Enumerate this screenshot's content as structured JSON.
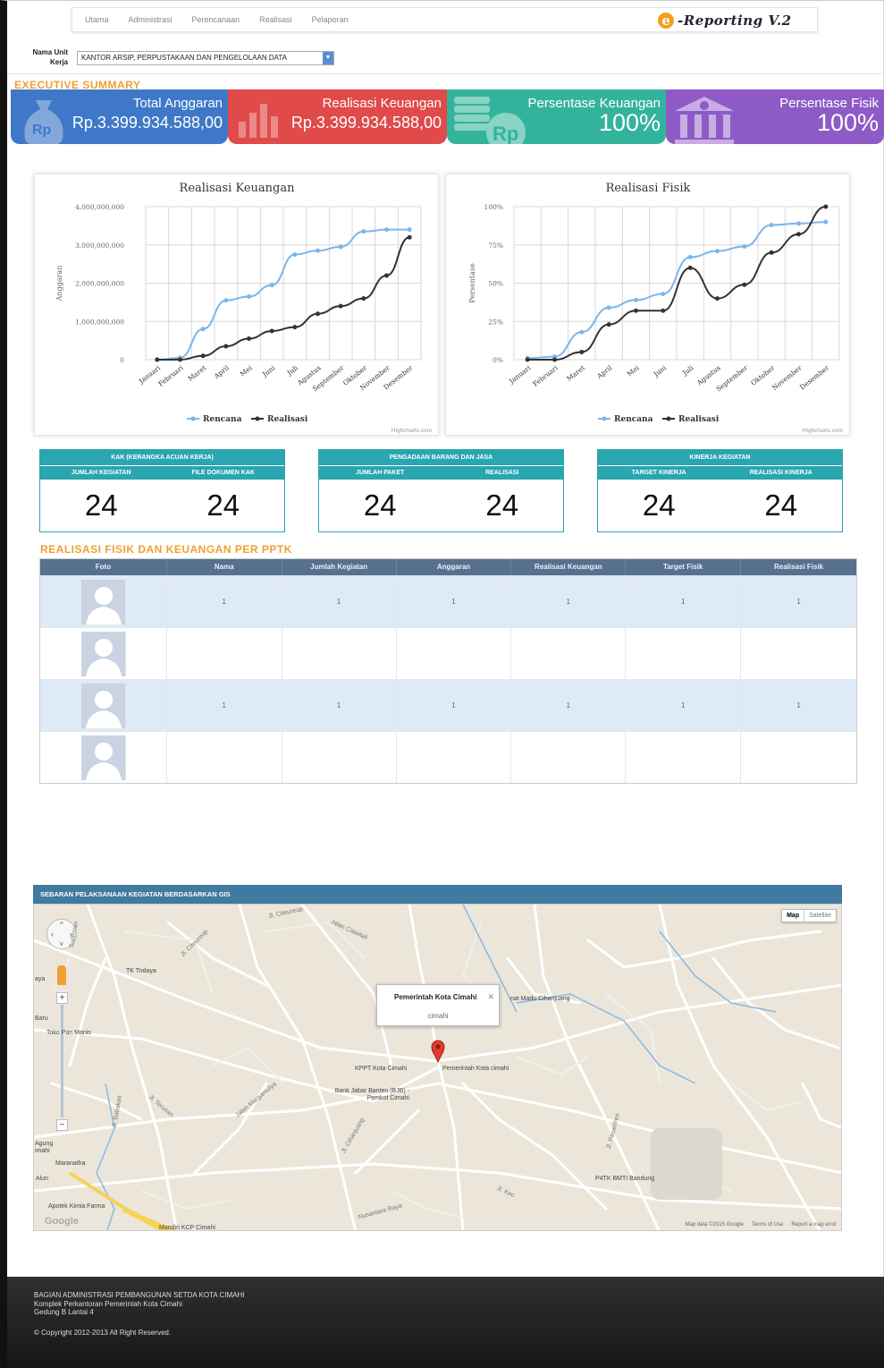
{
  "nav": {
    "items": [
      "Utama",
      "Administrasi",
      "Perencanaan",
      "Realisasi",
      "Pelaporan"
    ],
    "logo_letter": "e",
    "logo_text": "-Reporting V.2"
  },
  "unit": {
    "label": "Nama Unit Kerja",
    "selected": "KANTOR ARSIP, PERPUSTAKAAN DAN PENGELOLAAN DATA"
  },
  "executive_summary": {
    "title": "EXECUTIVE SUMMARY",
    "cards": [
      {
        "title": "Total Anggaran",
        "value": "Rp.3.399.934.588,00",
        "icon": "money-bag-icon",
        "color": "#3f78c8"
      },
      {
        "title": "Realisasi Keuangan",
        "value": "Rp.3.399.934.588,00",
        "icon": "bar-chart-icon",
        "color": "#e04a4a"
      },
      {
        "title": "Persentase Keuangan",
        "value": "100%",
        "icon": "coin-stack-icon",
        "color": "#34b39c"
      },
      {
        "title": "Persentase Fisik",
        "value": "100%",
        "icon": "bank-icon",
        "color": "#8e5bc6"
      }
    ]
  },
  "charts": {
    "months": [
      "Januari",
      "Februari",
      "Maret",
      "April",
      "Mei",
      "Juni",
      "Juli",
      "Agustus",
      "September",
      "Oktober",
      "November",
      "Desember"
    ],
    "credit": "Highcharts.com",
    "legend": [
      "Rencana",
      "Realisasi"
    ],
    "colors": {
      "rencana": "#7cb5ec",
      "realisasi": "#333333"
    }
  },
  "chart_data": [
    {
      "type": "line",
      "title": "Realisasi Keuangan",
      "ylabel": "Anggaran",
      "xlabel": "",
      "ylim": [
        0,
        4000000000
      ],
      "yticks": [
        "4,000,000,000",
        "3,000,000,000",
        "2,000,000,000",
        "1,000,000,000",
        "0"
      ],
      "categories": [
        "Januari",
        "Februari",
        "Maret",
        "April",
        "Mei",
        "Juni",
        "Juli",
        "Agustus",
        "September",
        "Oktober",
        "November",
        "Desember"
      ],
      "series": [
        {
          "name": "Rencana",
          "values": [
            0,
            50000000,
            800000000,
            1550000000,
            1650000000,
            1950000000,
            2750000000,
            2850000000,
            2950000000,
            3350000000,
            3400000000,
            3400000000
          ]
        },
        {
          "name": "Realisasi",
          "values": [
            0,
            0,
            100000000,
            350000000,
            550000000,
            750000000,
            850000000,
            1200000000,
            1400000000,
            1600000000,
            2200000000,
            3200000000
          ]
        }
      ],
      "grid": true,
      "legend_position": "bottom"
    },
    {
      "type": "line",
      "title": "Realisasi Fisik",
      "ylabel": "Persentase",
      "xlabel": "",
      "ylim": [
        0,
        100
      ],
      "yticks": [
        "100%",
        "75%",
        "50%",
        "25%",
        "0%"
      ],
      "categories": [
        "Januari",
        "Februari",
        "Maret",
        "April",
        "Mei",
        "Juni",
        "Juli",
        "Agustus",
        "September",
        "Oktober",
        "November",
        "Desember"
      ],
      "series": [
        {
          "name": "Rencana",
          "values": [
            1,
            2,
            18,
            34,
            39,
            43,
            67,
            71,
            74,
            88,
            89,
            90
          ]
        },
        {
          "name": "Realisasi",
          "values": [
            0,
            0,
            5,
            23,
            32,
            32,
            60,
            40,
            49,
            70,
            82,
            100
          ]
        }
      ],
      "grid": true,
      "legend_position": "bottom"
    }
  ],
  "stats": [
    {
      "title": "KAK (KERANGKA ACUAN KERJA)",
      "labels": [
        "JUMLAH KEGIATAN",
        "FILE DOKUMEN KAK"
      ],
      "values": [
        "24",
        "24"
      ]
    },
    {
      "title": "PENGADAAN BARANG DAN JASA",
      "labels": [
        "JUMLAH PAKET",
        "REALISASI"
      ],
      "values": [
        "24",
        "24"
      ]
    },
    {
      "title": "KINERJA KEGIATAN",
      "labels": [
        "TARGET KINERJA",
        "REALISASI KINERJA"
      ],
      "values": [
        "24",
        "24"
      ]
    }
  ],
  "pptk": {
    "title": "REALISASI FISIK DAN KEUANGAN PER PPTK",
    "columns": [
      "Foto",
      "Nama",
      "Jumlah Kegiatan",
      "Anggaran",
      "Realisasi Keuangan",
      "Target Fisik",
      "Realisasi Fisik"
    ],
    "rows": [
      [
        "1",
        "1",
        "1",
        "1",
        "1",
        "1"
      ],
      [
        "",
        "",
        "",
        "",
        "",
        ""
      ],
      [
        "1",
        "1",
        "1",
        "1",
        "1",
        "1"
      ],
      [
        "",
        "",
        "",
        "",
        "",
        ""
      ]
    ]
  },
  "map": {
    "title": "SEBARAN PELAKSANAAN KEGIATAN BERDASARKAN GIS",
    "type_map": "Map",
    "type_satellite": "Satellite",
    "info_title": "Pemerintah Kota Cimahi",
    "info_sub": "cimahi",
    "places": [
      "TK Tridaya",
      "Toko Pan Manis",
      "KPPT Kota Cimahi",
      "Pemerintah Kota cimahi",
      "Bank Jabar Banten (BJB) - Pemkot Cimahi",
      "P4TK BMTI Bandung",
      "Apotek Kimia Farma",
      "Maranatha",
      "Alun",
      "Agung imahi",
      "Baru",
      "aya",
      "nat Madu Cihanjuang",
      "Mandiri KCP Cimahi"
    ],
    "streets": [
      "Jl. Citeureup",
      "Jalan Ciawitali",
      "Jl. Citeureup",
      "Jalan Margamulya",
      "Jl. Terusan",
      "Jl. Babakan",
      "Jl. Cihanjuang",
      "Jl. Pasantren",
      "Jl. Kec",
      "Nusantara Raya",
      "Sudirman"
    ],
    "attribution": [
      "Map data ©2015 Google",
      "Terms of Use",
      "Report a map error"
    ],
    "google": "Google"
  },
  "footer": {
    "line1": "BAGIAN ADMINISTRASI PEMBANGUNAN SETDA KOTA CIMAHI",
    "line2": "Komplek Perkantoran Pemerintah Kota Cimahi",
    "line3": "Gedung B Lantai 4",
    "copyright": "© Copyright 2012-2013 All Right Reserved."
  }
}
